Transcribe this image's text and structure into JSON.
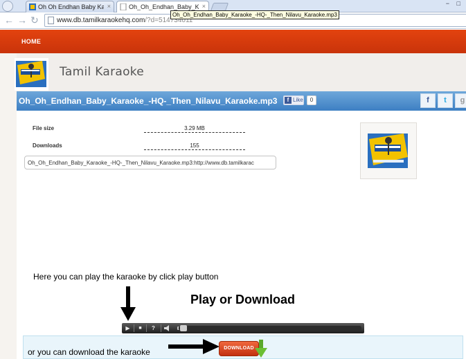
{
  "browser": {
    "tabs": [
      {
        "title": "Oh Oh Endhan Baby Karaoke",
        "active": false
      },
      {
        "title": "Oh_Oh_Endhan_Baby_Karaoke",
        "active": true
      }
    ],
    "address": {
      "host": "www.db.tamilkaraokehq.com",
      "query": "/?d=514734011"
    },
    "tooltip": "Oh_Oh_Endhan_Baby_Karaoke_-HQ-_Then_Nilavu_Karaoke.mp3"
  },
  "nav": {
    "home_label": "HOME"
  },
  "site": {
    "title": "Tamil Karaoke",
    "logo_icon": "tamil-karaoke-logo"
  },
  "file": {
    "title": "Oh_Oh_Endhan_Baby_Karaoke_-HQ-_Then_Nilavu_Karaoke.mp3",
    "like_label": "Like",
    "like_count": "0",
    "share_icons": [
      "facebook-icon",
      "twitter-icon",
      "google-plus-icon"
    ],
    "size_label": "File size",
    "size_value": "3.29 MB",
    "downloads_label": "Downloads",
    "downloads_value": "155",
    "link_value": "Oh_Oh_Endhan_Baby_Karaoke_-HQ-_Then_Nilavu_Karaoke.mp3:http://www.db.tamilkarac"
  },
  "player": {
    "hint": "Here you can play the karaoke by click play button",
    "heading": "Play or Download",
    "help_label": "?"
  },
  "download": {
    "hint": "or you can download the karaoke",
    "button_label": "DOWNLOAD"
  },
  "colors": {
    "nav_orange": "#d23a0c",
    "title_bar_blue": "#4a8acb",
    "download_panel": "#e9f5fb"
  }
}
